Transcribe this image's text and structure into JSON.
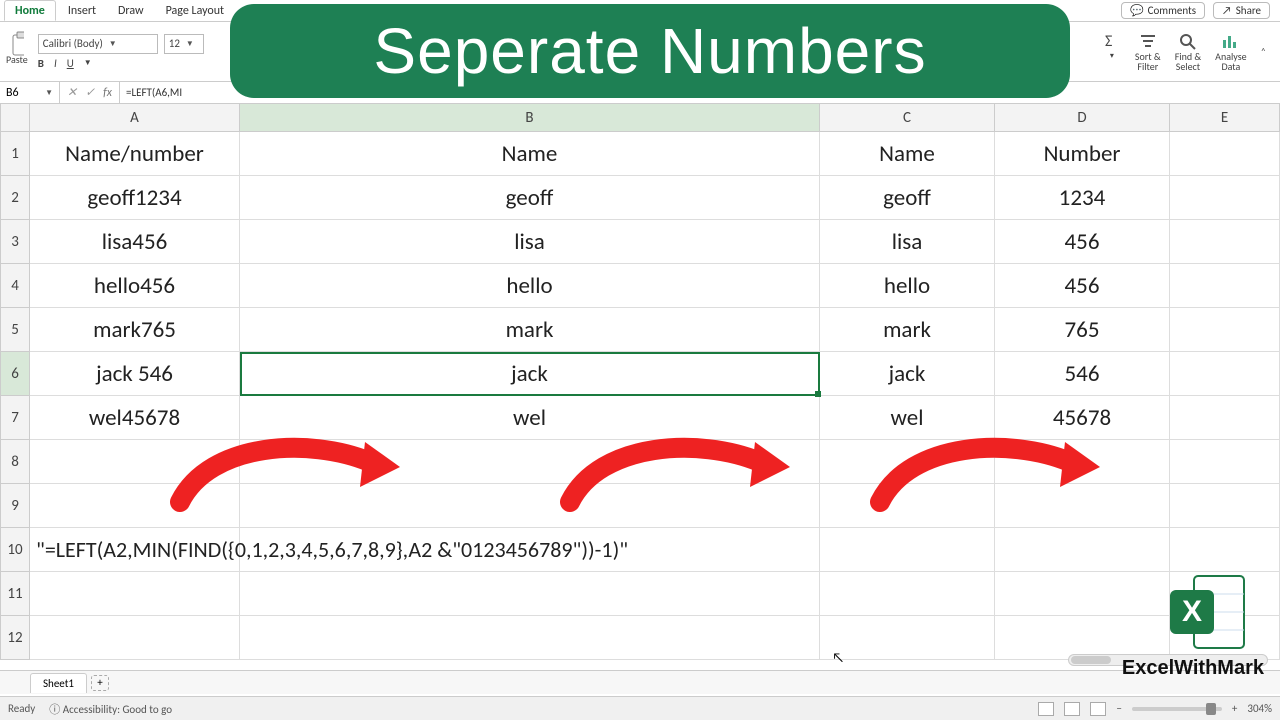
{
  "banner_title": "Seperate Numbers",
  "watermark": "ExcelWithMark",
  "tabs": {
    "home": "Home",
    "insert": "Insert",
    "draw": "Draw",
    "page_layout": "Page Layout"
  },
  "top_right": {
    "comments": "Comments",
    "share": "Share"
  },
  "ribbon": {
    "paste": "Paste",
    "font_name": "Calibri (Body)",
    "font_size": "12",
    "bold": "B",
    "italic": "I",
    "underline": "U",
    "sort_filter": "Sort &\nFilter",
    "find_select": "Find &\nSelect",
    "analyse": "Analyse\nData"
  },
  "formula_bar": {
    "cell_ref": "B6",
    "formula": "=LEFT(A6,MI"
  },
  "columns": [
    "A",
    "B",
    "C",
    "D",
    "E"
  ],
  "row_numbers": [
    "1",
    "2",
    "3",
    "4",
    "5",
    "6",
    "7",
    "8",
    "9",
    "10",
    "11",
    "12"
  ],
  "grid": {
    "r1": {
      "A": "Name/number",
      "B": "Name",
      "C": "Name",
      "D": "Number"
    },
    "r2": {
      "A": "geoff1234",
      "B": "geoff",
      "C": "geoff",
      "D": "1234"
    },
    "r3": {
      "A": "lisa456",
      "B": "lisa",
      "C": "lisa",
      "D": "456"
    },
    "r4": {
      "A": "hello456",
      "B": "hello",
      "C": "hello",
      "D": "456"
    },
    "r5": {
      "A": "mark765",
      "B": "mark",
      "C": "mark",
      "D": "765"
    },
    "r6": {
      "A": "jack 546",
      "B": "jack",
      "C": "jack",
      "D": "546"
    },
    "r7": {
      "A": "wel45678",
      "B": "wel",
      "C": "wel",
      "D": "45678"
    },
    "r10": {
      "A": "\"=LEFT(A2,MIN(FIND({0,1,2,3,4,5,6,7,8,9},A2 &\"0123456789\"))-1)\""
    }
  },
  "sheet_tab": "Sheet1",
  "status": {
    "ready": "Ready",
    "accessibility": "Accessibility: Good to go",
    "zoom": "304%"
  }
}
